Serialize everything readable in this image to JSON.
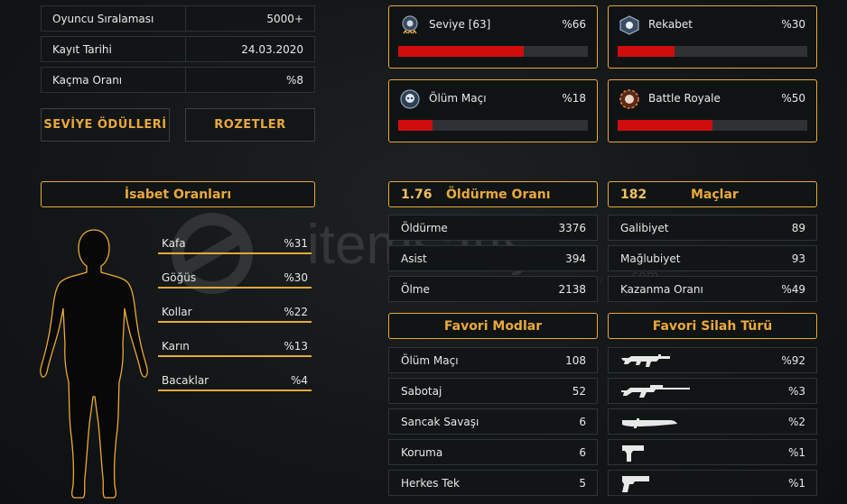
{
  "profile": {
    "rows": [
      {
        "label": "Oyuncu Sıralaması",
        "value": "5000+"
      },
      {
        "label": "Kayıt Tarihi",
        "value": "24.03.2020"
      },
      {
        "label": "Kaçma Oranı",
        "value": "%8"
      }
    ],
    "buttons": {
      "rewards": "SEVİYE ÖDÜLLERİ",
      "badges": "ROZETLER"
    }
  },
  "modes": [
    {
      "name": "Seviye [63]",
      "pct": "%66",
      "level": 0.66
    },
    {
      "name": "Rekabet",
      "pct": "%30",
      "level": 0.3
    },
    {
      "name": "Ölüm Maçı",
      "pct": "%18",
      "level": 0.18
    },
    {
      "name": "Battle Royale",
      "pct": "%50",
      "level": 0.5
    }
  ],
  "accuracy": {
    "title": "İsabet Oranları",
    "areas": [
      {
        "label": "Kafa",
        "value": "%31"
      },
      {
        "label": "Göğüs",
        "value": "%30"
      },
      {
        "label": "Kollar",
        "value": "%22"
      },
      {
        "label": "Karın",
        "value": "%13"
      },
      {
        "label": "Bacaklar",
        "value": "%4"
      }
    ]
  },
  "kills": {
    "ratio": "1.76",
    "title": "Öldürme Oranı",
    "rows": [
      {
        "label": "Öldürme",
        "value": "3376"
      },
      {
        "label": "Asist",
        "value": "394"
      },
      {
        "label": "Ölme",
        "value": "2138"
      }
    ]
  },
  "matches": {
    "count": "182",
    "title": "Maçlar",
    "rows": [
      {
        "label": "Galibiyet",
        "value": "89"
      },
      {
        "label": "Mağlubiyet",
        "value": "93"
      },
      {
        "label": "Kazanma Oranı",
        "value": "%49"
      }
    ]
  },
  "fav_modes": {
    "title": "Favori Modlar",
    "rows": [
      {
        "label": "Ölüm Maçı",
        "value": "108"
      },
      {
        "label": "Sabotaj",
        "value": "52"
      },
      {
        "label": "Sancak Savaşı",
        "value": "6"
      },
      {
        "label": "Koruma",
        "value": "6"
      },
      {
        "label": "Herkes Tek",
        "value": "5"
      }
    ]
  },
  "fav_weapons": {
    "title": "Favori Silah Türü",
    "rows": [
      {
        "icon": "rifle-icon",
        "value": "%92"
      },
      {
        "icon": "sniper-icon",
        "value": "%3"
      },
      {
        "icon": "knife-icon",
        "value": "%2"
      },
      {
        "icon": "smg-icon",
        "value": "%1"
      },
      {
        "icon": "pistol-icon",
        "value": "%1"
      }
    ]
  },
  "watermark": {
    "brand": "itemsatış",
    "tagline": "HESAP / SKIN / İTEM / E-PİN",
    "domain": ".com"
  },
  "colors": {
    "accent": "#e9a93a",
    "bar": "#d00d0d"
  }
}
